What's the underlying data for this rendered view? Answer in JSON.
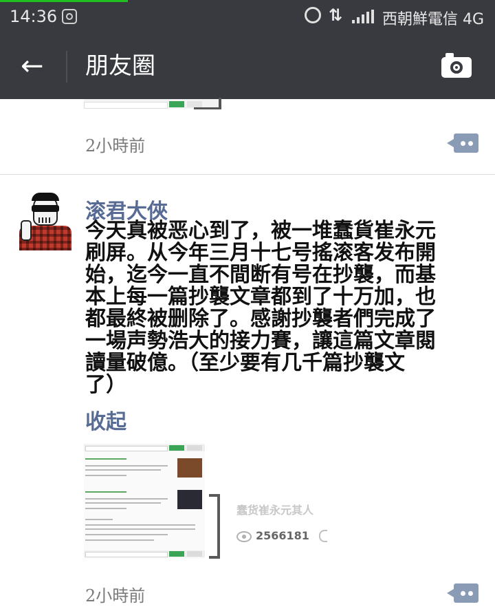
{
  "status_bar": {
    "time": "14:36",
    "carrier": "西朝鮮電信 4G",
    "data_arrows": "⇅",
    "colors": {
      "background": "#393a3f",
      "progress": "#20c020"
    }
  },
  "title_bar": {
    "back_icon": "back-arrow-icon",
    "title": "朋友圈",
    "camera_icon": "camera-icon"
  },
  "previous_post": {
    "time": "2小時前",
    "comment_icon": "comment-dots-icon"
  },
  "post": {
    "author": "滚君大俠",
    "text": "今天真被恶心到了，被一堆蠢貨崔永元\n刷屏。从今年三月十七号搖滚客发布開\n始，迄今一直不間断有号在抄襲，而基\n本上每一篇抄襲文章都到了十万加，也\n都最終被删除了。感謝抄襲者們完成了\n一場声勢浩大的接力賽，讓這篇文章閱\n讀量破億。（至少要有几千篇抄襲文\n了）",
    "collapse_label": "收起",
    "shared_card": {
      "title": "蠢货崔永元其人",
      "views": "2566181",
      "eye_icon": "eye-icon",
      "like_icon": "like-icon"
    },
    "time": "2小時前",
    "comment_icon": "comment-dots-icon"
  },
  "colors": {
    "link_blue": "#576b95",
    "comment_button": "#8a9bb5",
    "time_gray": "#7a7a7a"
  }
}
